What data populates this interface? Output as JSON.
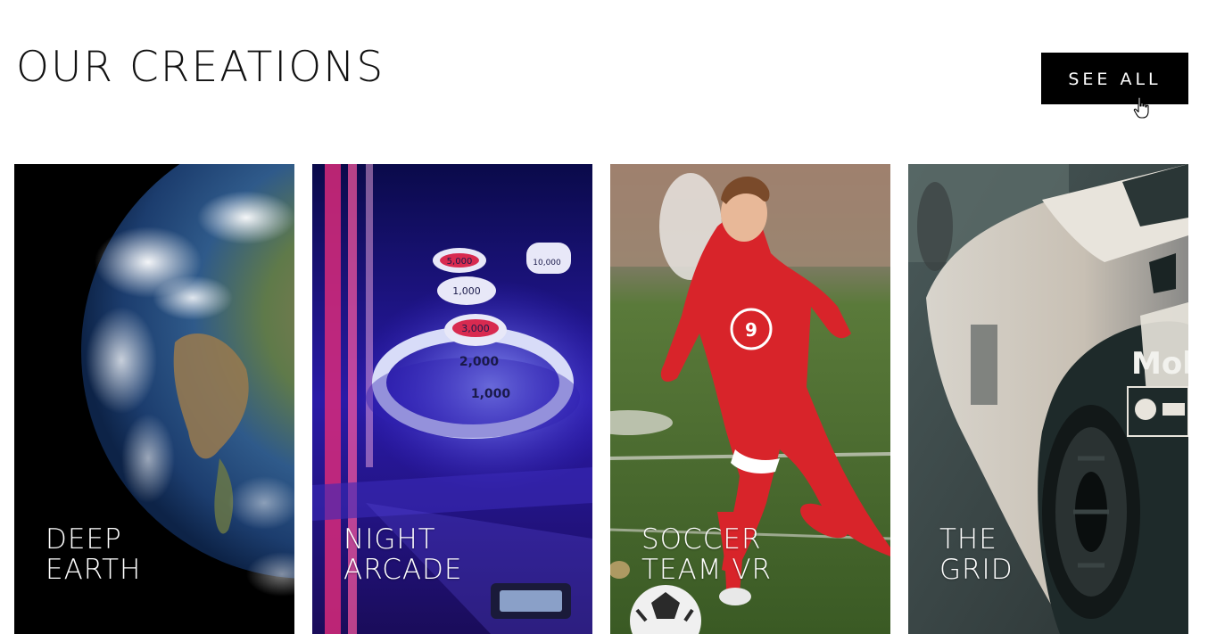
{
  "section": {
    "title": "OUR CREATIONS",
    "see_all_label": "SEE ALL"
  },
  "cards": [
    {
      "label": "DEEP\nEARTH",
      "image": "earth-from-space"
    },
    {
      "label": "NIGHT\nARCADE",
      "image": "skeeball-arcade-neon"
    },
    {
      "label": "SOCCER\nTEAM VR",
      "image": "soccer-player-red-kit"
    },
    {
      "label": "THE\nGRID",
      "image": "race-car-closeup"
    }
  ],
  "arcade_scores": [
    "10,000",
    "5,000",
    "3,000",
    "2,000",
    "1,000",
    "1,000"
  ],
  "car_sponsor_text": "Mob"
}
